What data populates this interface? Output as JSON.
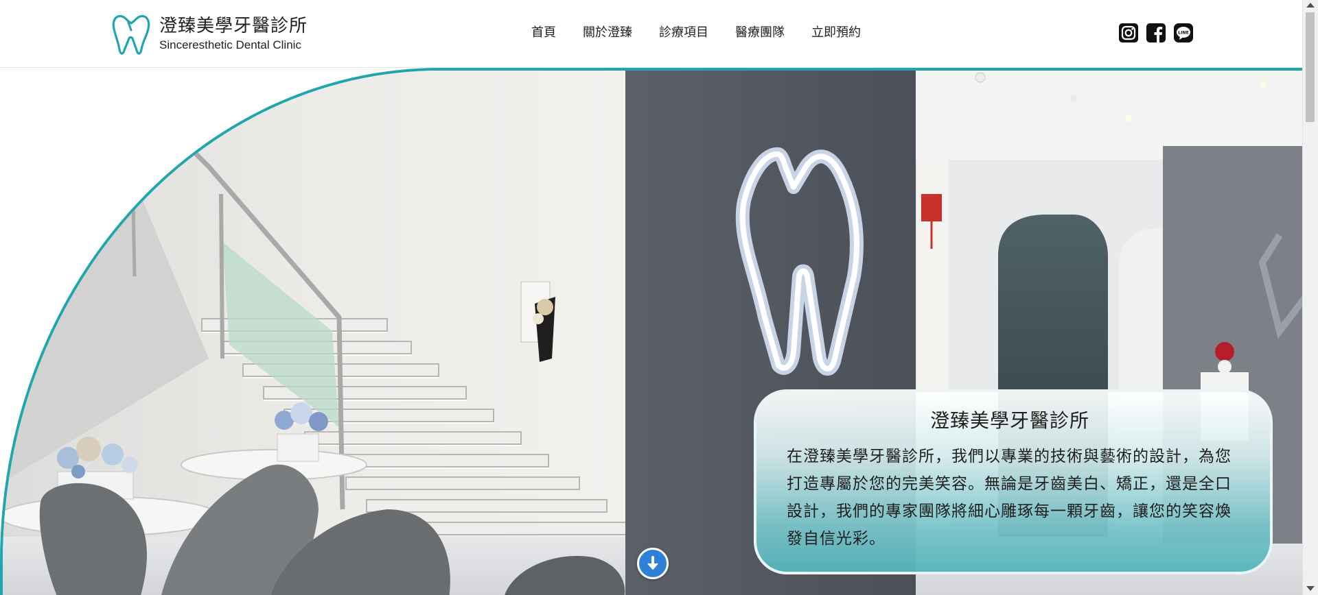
{
  "brand": {
    "name_zh": "澄臻美學牙醫診所",
    "name_en": "Sinceresthetic Dental Clinic",
    "logo_icon": "tooth-logo-icon",
    "accent_color": "#1fa6ad"
  },
  "nav": {
    "items": [
      {
        "label": "首頁"
      },
      {
        "label": "關於澄臻"
      },
      {
        "label": "診療項目"
      },
      {
        "label": "醫療團隊"
      },
      {
        "label": "立即預約"
      }
    ]
  },
  "social": {
    "icons": [
      "instagram-icon",
      "facebook-icon",
      "line-icon"
    ]
  },
  "hero": {
    "card_title": "澄臻美學牙醫診所",
    "card_body": "在澄臻美學牙醫診所，我們以專業的技術與藝術的設計，為您打造專屬於您的完美笑容。無論是牙齒美白、矯正，還是全口設計，我們的專家團隊將細心雕琢每一顆牙齒，讓您的笑容煥發自信光彩。",
    "scroll_button_icon": "arrow-down-icon",
    "scroll_button_color": "#2f80d8"
  }
}
